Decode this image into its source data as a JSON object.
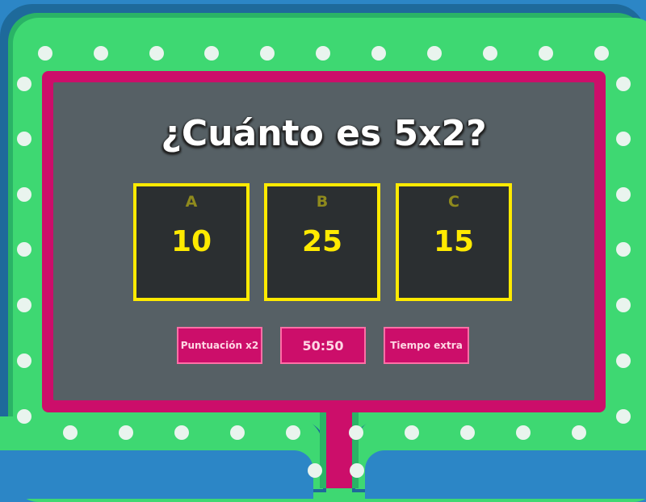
{
  "question": "¿Cuánto es 5x2?",
  "answers": [
    {
      "letter": "A",
      "value": "10"
    },
    {
      "letter": "B",
      "value": "25"
    },
    {
      "letter": "C",
      "value": "15"
    }
  ],
  "powerups": [
    {
      "label": "Puntuación x2"
    },
    {
      "label": "50:50"
    },
    {
      "label": "Tiempo extra"
    }
  ],
  "colors": {
    "frame_blue": "#2c86c6",
    "frame_green": "#3ed872",
    "border_pink": "#cc0e6a",
    "screen_gray": "#566065",
    "answer_yellow": "#ffea00",
    "answer_bg": "#2b2f31"
  }
}
